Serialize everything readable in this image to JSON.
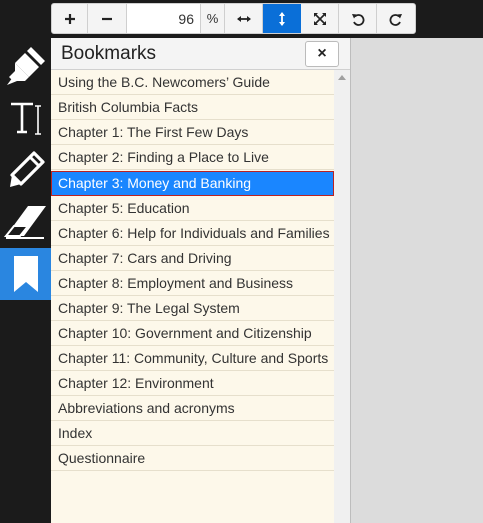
{
  "toolbar": {
    "zoom_value": "96",
    "zoom_unit": "%",
    "icons": [
      "zoom-in-icon",
      "zoom-out-icon",
      "fit-width-icon",
      "fit-height-icon",
      "fullscreen-icon",
      "rotate-left-icon",
      "rotate-right-icon"
    ]
  },
  "tools": [
    "highlighter-icon",
    "text-icon",
    "pencil-icon",
    "eraser-icon",
    "bookmark-icon"
  ],
  "bookmarks": {
    "title": "Bookmarks",
    "close_label": "×",
    "selected_index": 4,
    "items": [
      "Using the B.C. Newcomers’ Guide",
      "British Columbia Facts",
      "Chapter 1: The First Few Days",
      "Chapter 2: Finding a Place to Live",
      "Chapter 3: Money and Banking",
      "Chapter 5: Education",
      "Chapter 6: Help for Individuals and Families",
      "Chapter 7: Cars and Driving",
      "Chapter 8: Employment and Business",
      "Chapter 9: The Legal System",
      "Chapter 10: Government and Citizenship",
      "Chapter 11: Community, Culture and Sports",
      "Chapter 12: Environment",
      "Abbreviations and acronyms",
      "Index",
      "Questionnaire"
    ]
  },
  "colors": {
    "accent": "#0a6fd8",
    "selected": "#1a86ff",
    "list_bg": "#fdf8ea",
    "rail_bg": "#1b1b1b"
  }
}
